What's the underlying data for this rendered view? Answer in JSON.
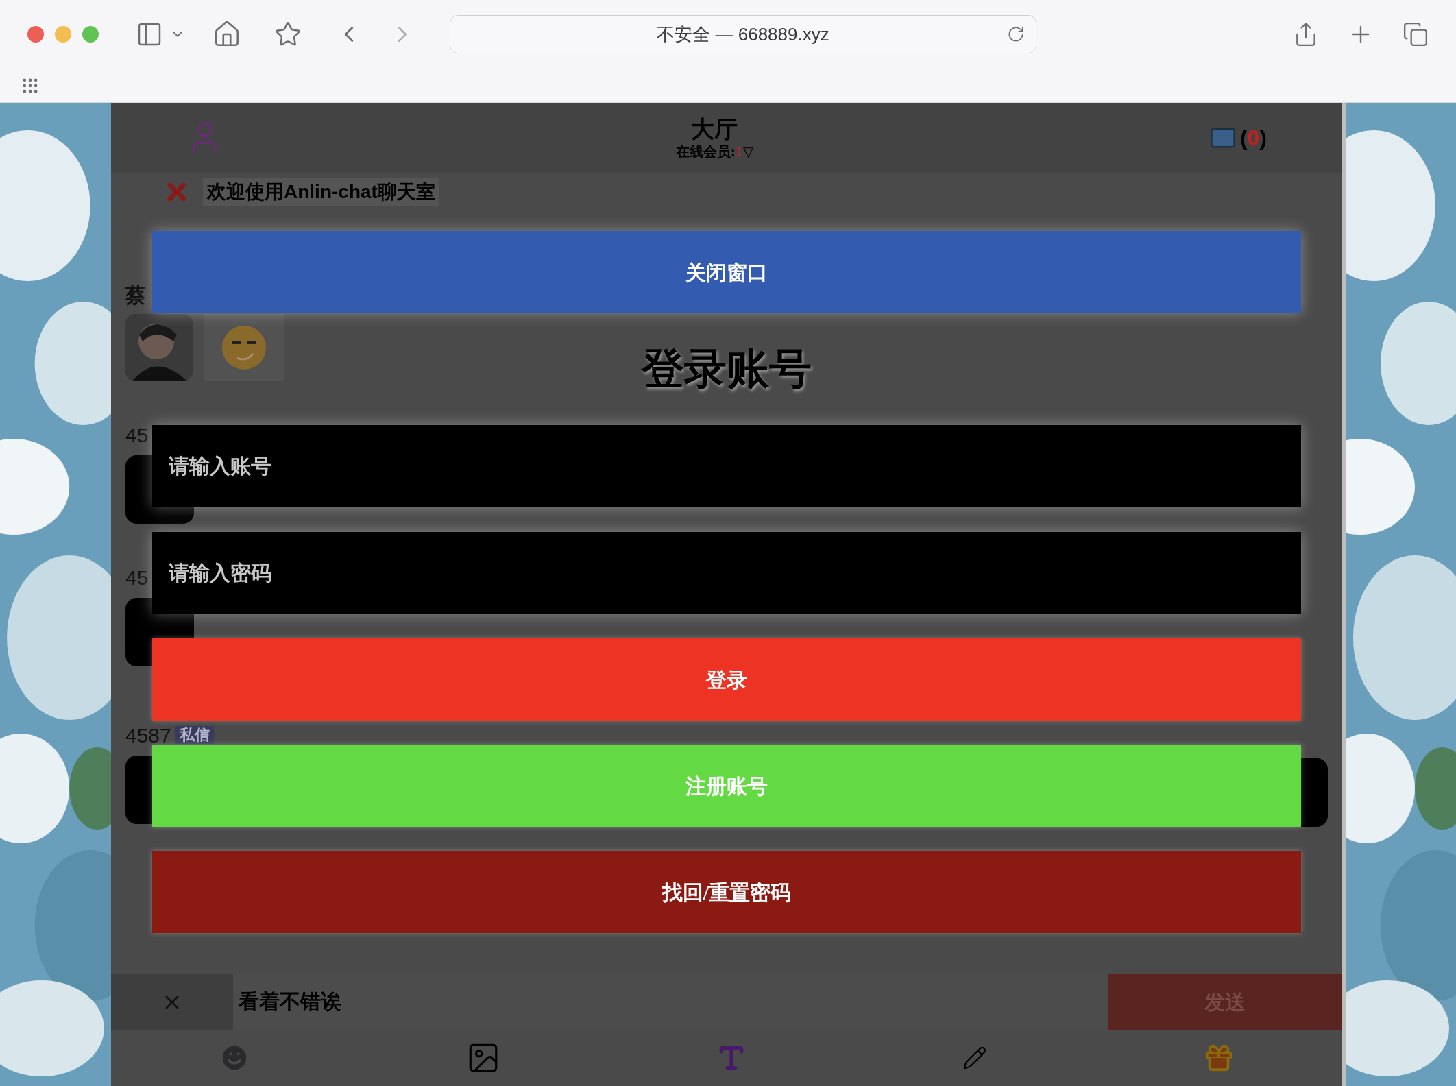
{
  "browser": {
    "address": "不安全 — 668889.xyz"
  },
  "header": {
    "title": "大厅",
    "online_label": "在线会员:",
    "online_count": "1",
    "dropdown": "▽",
    "mail_open": "(",
    "mail_count": "0",
    "mail_close": ")"
  },
  "welcome": "欢迎使用Anlin-chat聊天室",
  "messages": [
    {
      "sender": "蔡",
      "kind": "images"
    },
    {
      "sender": "45",
      "kind": "bubble"
    },
    {
      "sender": "45",
      "kind": "bubble"
    },
    {
      "sender": "4587",
      "tag": "私信",
      "kind": "bubble"
    }
  ],
  "login": {
    "close": "关闭窗口",
    "title": "登录账号",
    "account_placeholder": "请输入账号",
    "password_placeholder": "请输入密码",
    "buttons": [
      {
        "label": "登录",
        "kind": "login"
      },
      {
        "label": "注册账号",
        "kind": "register"
      },
      {
        "label": "找回/重置密码",
        "kind": "reset"
      }
    ]
  },
  "composer": {
    "value": "看着不错诶",
    "send": "发送"
  }
}
